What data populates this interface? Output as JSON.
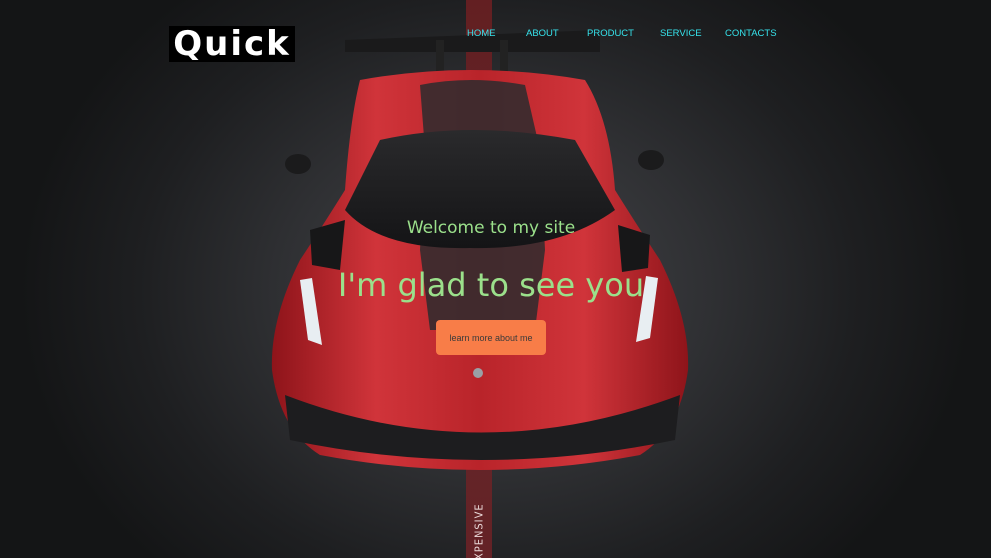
{
  "logo": {
    "text": "Quick"
  },
  "nav": {
    "items": [
      {
        "label": "HOME"
      },
      {
        "label": "ABOUT"
      },
      {
        "label": "PRODUCT"
      },
      {
        "label": "SERVICE"
      },
      {
        "label": "CONTACTS"
      }
    ]
  },
  "hero": {
    "subtitle": "Welcome to my site",
    "headline": "I'm glad to see you",
    "cta_label": "learn more about me",
    "road_text": "XPENSIVE"
  },
  "colors": {
    "nav_text": "#36e3ec",
    "hero_text": "#9be08b",
    "cta_background": "#f87d48",
    "car_red": "#c8262c",
    "background": "#2f3033"
  },
  "icons": {
    "car_image": "sports-car-top-view"
  }
}
